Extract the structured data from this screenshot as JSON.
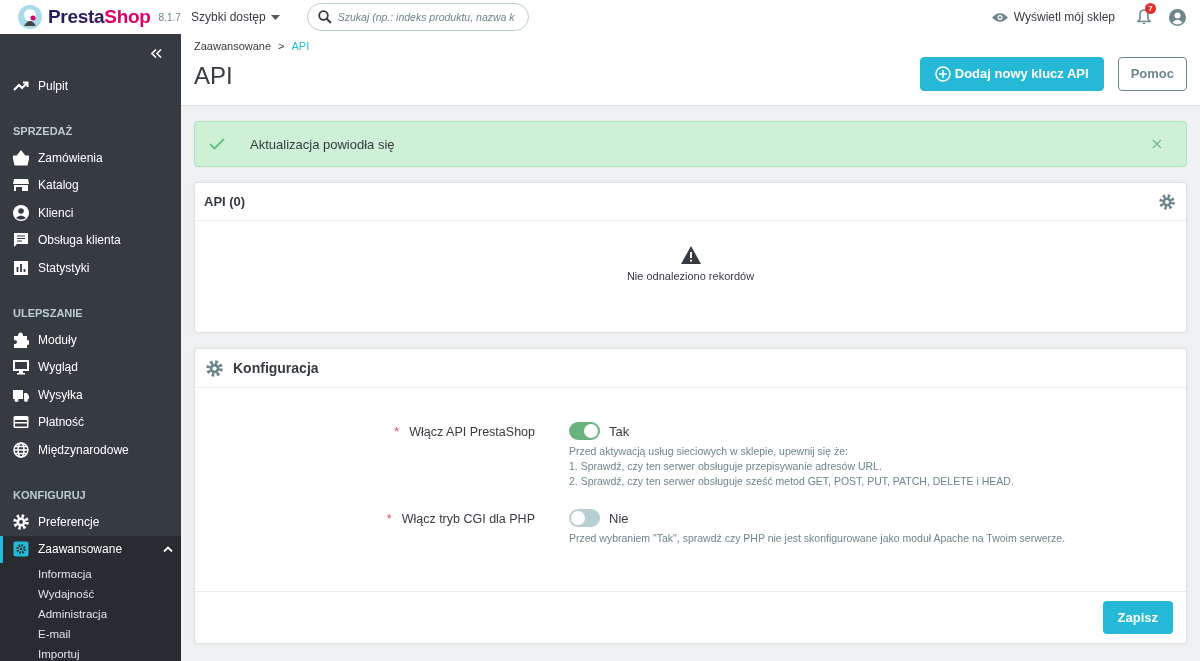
{
  "header": {
    "brand_first": "Presta",
    "brand_second": "Shop",
    "version": "8.1.7",
    "quick_access": "Szybki dostęp",
    "search": {
      "placeholder": "Szukaj (np.: indeks produktu, nazwa k"
    },
    "view_shop": "Wyświetl mój sklep",
    "notifications": "7"
  },
  "sidebar": {
    "top": [
      {
        "kind": "trend",
        "label": "Pulpit",
        "selected": false
      }
    ],
    "sections": [
      {
        "title": "SPRZEDAŻ",
        "items": [
          {
            "kind": "basket",
            "label": "Zamówienia",
            "selected": false
          },
          {
            "kind": "store",
            "label": "Katalog",
            "selected": false
          },
          {
            "kind": "person",
            "label": "Klienci",
            "selected": false
          },
          {
            "kind": "chat",
            "label": "Obsługa klienta",
            "selected": false
          },
          {
            "kind": "chart",
            "label": "Statystyki",
            "selected": false
          }
        ]
      },
      {
        "title": "ULEPSZANIE",
        "items": [
          {
            "kind": "puzzle",
            "label": "Moduły",
            "selected": false
          },
          {
            "kind": "monitor",
            "label": "Wygląd",
            "selected": false
          },
          {
            "kind": "truck",
            "label": "Wysyłka",
            "selected": false
          },
          {
            "kind": "card",
            "label": "Płatność",
            "selected": false
          },
          {
            "kind": "globe",
            "label": "Międzynarodowe",
            "selected": false
          }
        ]
      },
      {
        "title": "KONFIGURUJ",
        "items": [
          {
            "kind": "gear",
            "label": "Preferencje",
            "selected": false
          },
          {
            "kind": "gearbox",
            "label": "Zaawansowane",
            "selected": true,
            "expanded": true,
            "children": [
              {
                "label": "Informacja"
              },
              {
                "label": "Wydajność"
              },
              {
                "label": "Administracja"
              },
              {
                "label": "E-mail"
              },
              {
                "label": "Importuj"
              }
            ]
          }
        ]
      }
    ]
  },
  "breadcrumb": [
    {
      "label": "Zaawansowane",
      "current": false
    },
    {
      "label": "API",
      "current": true
    }
  ],
  "breadcrumb_separator": ">",
  "page_title": "API",
  "toolbar": [
    {
      "kind": "primary",
      "label": "Dodaj nowy klucz API"
    },
    {
      "kind": "secondary",
      "label": "Pomoc"
    }
  ],
  "alert": {
    "text": "Aktualizacja powiodła się"
  },
  "api_panel": {
    "title": "API (0)",
    "empty": "Nie odnaleziono rekordów"
  },
  "config": {
    "title": "Konfiguracja",
    "fields": [
      {
        "label": "Włącz API PrestaShop",
        "required_mark": "*",
        "on": true,
        "value_label": "Tak",
        "help": [
          "Przed aktywacją usług sieciowych w sklepie, upewnij się że:",
          "1. Sprawdź, czy ten serwer obsługuje przepisywanie adresów URL.",
          "2. Sprawdź, czy ten serwer obsługuje sześć metod GET, POST, PUT, PATCH, DELETE i HEAD."
        ]
      },
      {
        "label": "Włącz tryb CGI dla PHP",
        "required_mark": "*",
        "on": false,
        "value_label": "Nie",
        "help": [
          "Przed wybraniem \"Tak\", sprawdź czy PHP nie jest skonfigurowane jako moduł Apache na Twoim serwerze."
        ]
      }
    ],
    "save": "Zapisz"
  }
}
